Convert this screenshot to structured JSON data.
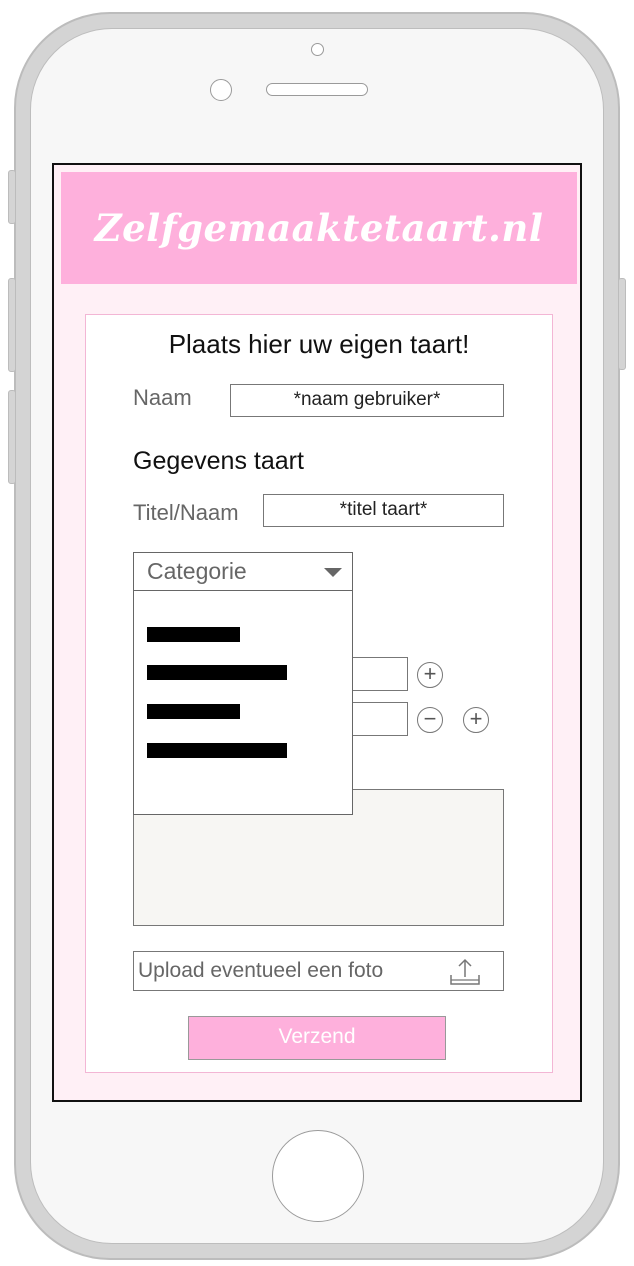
{
  "site": {
    "logo": "Zelfgemaaktetaart.nl"
  },
  "form": {
    "heading": "Plaats hier uw eigen taart!",
    "name_label": "Naam",
    "name_value": "*naam gebruiker*",
    "section_title": "Gegevens taart",
    "title_label": "Titel/Naam",
    "title_value": "*titel taart*",
    "category": {
      "selected": "Categorie",
      "options": [
        "",
        "",
        "",
        ""
      ]
    },
    "upload_label": "Upload eventueel een foto",
    "submit_label": "Verzend"
  },
  "icons": {
    "plus": "plus-circle-icon",
    "minus": "minus-circle-icon",
    "upload": "upload-icon",
    "dropdown": "chevron-down-icon"
  },
  "colors": {
    "brand_pink": "#feb0dc",
    "background_pink": "#fff0f6"
  }
}
